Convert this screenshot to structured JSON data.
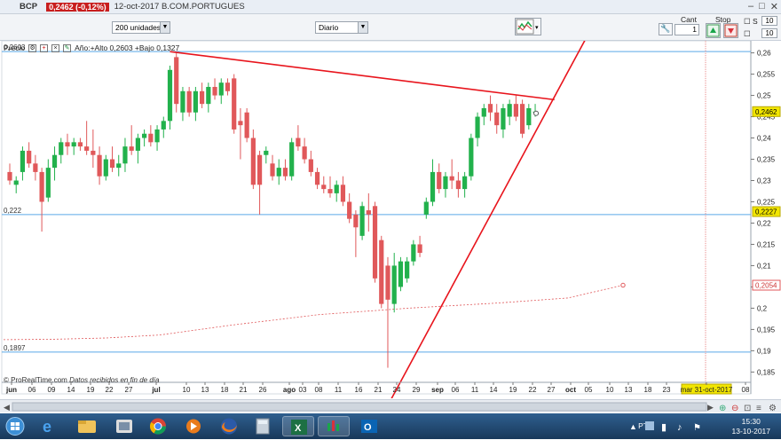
{
  "titlebar": {
    "symbol": "BCP",
    "price_change": "0,2462 (-0,12%)",
    "date_market": "12-oct-2017  B.COM.PORTUGUES"
  },
  "toolbar": {
    "units_value": "200 unidades",
    "period_value": "Diario",
    "cant_label": "Cant",
    "cant_value": "1",
    "stop_label": "Stop",
    "s_label": "S",
    "s_value": "10",
    "p_value": "10"
  },
  "legend": {
    "label": "Precio",
    "stats": "Año:+Alto 0,2603 +Bajo 0,1327"
  },
  "footer": {
    "provider": "© ProRealTime.com",
    "note": "Datos recibidos en fin de día"
  },
  "taskbar": {
    "lang": "PT",
    "time": "15:30",
    "date": "13-10-2017"
  },
  "colors": {
    "up": "#22b14c",
    "down": "#e0585a",
    "trend": "#e8141c",
    "hline": "#5aa9e6",
    "last_badge": "#f2e600"
  },
  "chart_data": {
    "type": "candlestick",
    "ylim": [
      0.182,
      0.264
    ],
    "y_ticks": [
      "0,26",
      "0,255",
      "0,25",
      "0,245",
      "0,24",
      "0,235",
      "0,23",
      "0,225",
      "0,22",
      "0,215",
      "0,21",
      "0,205",
      "0,2",
      "0,195",
      "0,19",
      "0,185"
    ],
    "y_tick_values": [
      0.26,
      0.255,
      0.25,
      0.245,
      0.24,
      0.235,
      0.23,
      0.225,
      0.22,
      0.215,
      0.21,
      0.205,
      0.2,
      0.195,
      0.19,
      0.185
    ],
    "x_labels": [
      "jun",
      "06",
      "09",
      "14",
      "19",
      "22",
      "27",
      "jul",
      "10",
      "13",
      "18",
      "21",
      "26",
      "ago",
      "03",
      "08",
      "11",
      "16",
      "21",
      "24",
      "29",
      "sep",
      "06",
      "11",
      "14",
      "19",
      "22",
      "27",
      "oct",
      "05",
      "10",
      "13",
      "18",
      "23",
      "mar 31-oct-2017",
      "08"
    ],
    "x_label_pos": [
      13,
      36,
      58,
      80,
      102,
      123,
      145,
      176,
      210,
      231,
      253,
      274,
      296,
      326,
      341,
      359,
      381,
      404,
      426,
      447,
      469,
      493,
      513,
      535,
      556,
      578,
      600,
      621,
      643,
      663,
      687,
      708,
      730,
      751,
      796,
      840
    ],
    "hlines": [
      {
        "label": "0,2603",
        "value": 0.2603
      },
      {
        "label": "0,222",
        "value": 0.222
      },
      {
        "label": "0,1897",
        "value": 0.1897
      }
    ],
    "right_badges": [
      {
        "label": "0,2462",
        "value": 0.2462,
        "kind": "last"
      },
      {
        "label": "0,2227",
        "value": 0.2227,
        "kind": "level"
      },
      {
        "label": "0,2054",
        "value": 0.2054,
        "kind": "ma"
      }
    ],
    "candles": [
      {
        "o": 0.232,
        "h": 0.234,
        "l": 0.229,
        "c": 0.23
      },
      {
        "o": 0.229,
        "h": 0.231,
        "l": 0.227,
        "c": 0.23
      },
      {
        "o": 0.232,
        "h": 0.238,
        "l": 0.23,
        "c": 0.237
      },
      {
        "o": 0.237,
        "h": 0.239,
        "l": 0.233,
        "c": 0.234
      },
      {
        "o": 0.234,
        "h": 0.236,
        "l": 0.23,
        "c": 0.232
      },
      {
        "o": 0.232,
        "h": 0.233,
        "l": 0.218,
        "c": 0.225
      },
      {
        "o": 0.226,
        "h": 0.235,
        "l": 0.225,
        "c": 0.233
      },
      {
        "o": 0.233,
        "h": 0.238,
        "l": 0.23,
        "c": 0.236
      },
      {
        "o": 0.236,
        "h": 0.24,
        "l": 0.234,
        "c": 0.239
      },
      {
        "o": 0.239,
        "h": 0.241,
        "l": 0.236,
        "c": 0.238
      },
      {
        "o": 0.238,
        "h": 0.24,
        "l": 0.236,
        "c": 0.239
      },
      {
        "o": 0.239,
        "h": 0.24,
        "l": 0.237,
        "c": 0.238
      },
      {
        "o": 0.238,
        "h": 0.244,
        "l": 0.236,
        "c": 0.237
      },
      {
        "o": 0.237,
        "h": 0.242,
        "l": 0.233,
        "c": 0.236
      },
      {
        "o": 0.236,
        "h": 0.238,
        "l": 0.229,
        "c": 0.231
      },
      {
        "o": 0.231,
        "h": 0.236,
        "l": 0.23,
        "c": 0.235
      },
      {
        "o": 0.235,
        "h": 0.238,
        "l": 0.232,
        "c": 0.233
      },
      {
        "o": 0.233,
        "h": 0.236,
        "l": 0.231,
        "c": 0.234
      },
      {
        "o": 0.234,
        "h": 0.24,
        "l": 0.232,
        "c": 0.238
      },
      {
        "o": 0.238,
        "h": 0.243,
        "l": 0.236,
        "c": 0.237
      },
      {
        "o": 0.237,
        "h": 0.241,
        "l": 0.234,
        "c": 0.24
      },
      {
        "o": 0.24,
        "h": 0.242,
        "l": 0.238,
        "c": 0.241
      },
      {
        "o": 0.241,
        "h": 0.243,
        "l": 0.238,
        "c": 0.239
      },
      {
        "o": 0.239,
        "h": 0.243,
        "l": 0.237,
        "c": 0.242
      },
      {
        "o": 0.242,
        "h": 0.245,
        "l": 0.24,
        "c": 0.244
      },
      {
        "o": 0.244,
        "h": 0.257,
        "l": 0.242,
        "c": 0.256
      },
      {
        "o": 0.259,
        "h": 0.26,
        "l": 0.246,
        "c": 0.248
      },
      {
        "o": 0.246,
        "h": 0.252,
        "l": 0.244,
        "c": 0.251
      },
      {
        "o": 0.251,
        "h": 0.252,
        "l": 0.245,
        "c": 0.246
      },
      {
        "o": 0.246,
        "h": 0.252,
        "l": 0.244,
        "c": 0.251
      },
      {
        "o": 0.251,
        "h": 0.253,
        "l": 0.247,
        "c": 0.248
      },
      {
        "o": 0.248,
        "h": 0.253,
        "l": 0.246,
        "c": 0.252
      },
      {
        "o": 0.252,
        "h": 0.254,
        "l": 0.249,
        "c": 0.25
      },
      {
        "o": 0.25,
        "h": 0.254,
        "l": 0.248,
        "c": 0.253
      },
      {
        "o": 0.253,
        "h": 0.254,
        "l": 0.25,
        "c": 0.251
      },
      {
        "o": 0.254,
        "h": 0.255,
        "l": 0.241,
        "c": 0.242
      },
      {
        "o": 0.244,
        "h": 0.247,
        "l": 0.235,
        "c": 0.243
      },
      {
        "o": 0.246,
        "h": 0.247,
        "l": 0.239,
        "c": 0.24
      },
      {
        "o": 0.24,
        "h": 0.242,
        "l": 0.228,
        "c": 0.229
      },
      {
        "o": 0.236,
        "h": 0.237,
        "l": 0.222,
        "c": 0.229
      },
      {
        "o": 0.236,
        "h": 0.238,
        "l": 0.234,
        "c": 0.237
      },
      {
        "o": 0.234,
        "h": 0.236,
        "l": 0.23,
        "c": 0.231
      },
      {
        "o": 0.231,
        "h": 0.235,
        "l": 0.229,
        "c": 0.233
      },
      {
        "o": 0.233,
        "h": 0.235,
        "l": 0.23,
        "c": 0.231
      },
      {
        "o": 0.231,
        "h": 0.24,
        "l": 0.23,
        "c": 0.239
      },
      {
        "o": 0.24,
        "h": 0.243,
        "l": 0.237,
        "c": 0.238
      },
      {
        "o": 0.238,
        "h": 0.24,
        "l": 0.234,
        "c": 0.235
      },
      {
        "o": 0.235,
        "h": 0.237,
        "l": 0.231,
        "c": 0.232
      },
      {
        "o": 0.232,
        "h": 0.233,
        "l": 0.228,
        "c": 0.229
      },
      {
        "o": 0.229,
        "h": 0.231,
        "l": 0.227,
        "c": 0.228
      },
      {
        "o": 0.228,
        "h": 0.231,
        "l": 0.226,
        "c": 0.227
      },
      {
        "o": 0.227,
        "h": 0.23,
        "l": 0.225,
        "c": 0.229
      },
      {
        "o": 0.229,
        "h": 0.231,
        "l": 0.224,
        "c": 0.225
      },
      {
        "o": 0.225,
        "h": 0.227,
        "l": 0.22,
        "c": 0.221
      },
      {
        "o": 0.222,
        "h": 0.223,
        "l": 0.212,
        "c": 0.219
      },
      {
        "o": 0.217,
        "h": 0.225,
        "l": 0.216,
        "c": 0.224
      },
      {
        "o": 0.223,
        "h": 0.227,
        "l": 0.218,
        "c": 0.222
      },
      {
        "o": 0.224,
        "h": 0.225,
        "l": 0.206,
        "c": 0.207
      },
      {
        "o": 0.216,
        "h": 0.217,
        "l": 0.2,
        "c": 0.201
      },
      {
        "o": 0.21,
        "h": 0.212,
        "l": 0.186,
        "c": 0.202
      },
      {
        "o": 0.201,
        "h": 0.213,
        "l": 0.199,
        "c": 0.21
      },
      {
        "o": 0.205,
        "h": 0.212,
        "l": 0.204,
        "c": 0.211
      },
      {
        "o": 0.207,
        "h": 0.212,
        "l": 0.206,
        "c": 0.211
      },
      {
        "o": 0.211,
        "h": 0.216,
        "l": 0.21,
        "c": 0.215
      },
      {
        "o": 0.215,
        "h": 0.217,
        "l": 0.212,
        "c": 0.213
      },
      {
        "o": 0.222,
        "h": 0.226,
        "l": 0.221,
        "c": 0.225
      },
      {
        "o": 0.225,
        "h": 0.235,
        "l": 0.224,
        "c": 0.232
      },
      {
        "o": 0.232,
        "h": 0.234,
        "l": 0.227,
        "c": 0.228
      },
      {
        "o": 0.228,
        "h": 0.232,
        "l": 0.226,
        "c": 0.231
      },
      {
        "o": 0.231,
        "h": 0.235,
        "l": 0.228,
        "c": 0.23
      },
      {
        "o": 0.23,
        "h": 0.232,
        "l": 0.226,
        "c": 0.228
      },
      {
        "o": 0.228,
        "h": 0.232,
        "l": 0.226,
        "c": 0.231
      },
      {
        "o": 0.231,
        "h": 0.241,
        "l": 0.23,
        "c": 0.24
      },
      {
        "o": 0.24,
        "h": 0.246,
        "l": 0.238,
        "c": 0.245
      },
      {
        "o": 0.245,
        "h": 0.248,
        "l": 0.243,
        "c": 0.247
      },
      {
        "o": 0.248,
        "h": 0.25,
        "l": 0.244,
        "c": 0.246
      },
      {
        "o": 0.246,
        "h": 0.248,
        "l": 0.241,
        "c": 0.243
      },
      {
        "o": 0.242,
        "h": 0.248,
        "l": 0.24,
        "c": 0.247
      },
      {
        "o": 0.245,
        "h": 0.249,
        "l": 0.243,
        "c": 0.248
      },
      {
        "o": 0.248,
        "h": 0.25,
        "l": 0.244,
        "c": 0.245
      },
      {
        "o": 0.248,
        "h": 0.249,
        "l": 0.24,
        "c": 0.241
      },
      {
        "o": 0.243,
        "h": 0.248,
        "l": 0.242,
        "c": 0.247
      },
      {
        "o": 0.246,
        "h": 0.248,
        "l": 0.245,
        "c": 0.2462
      }
    ],
    "moving_average": [
      0.1926,
      0.1927,
      0.193,
      0.1937,
      0.196,
      0.1985,
      0.2,
      0.2012,
      0.2024,
      0.2054
    ],
    "trendlines": [
      {
        "from": {
          "candle": 25,
          "value": 0.2603
        },
        "to": {
          "candle": 85,
          "value": 0.249
        }
      },
      {
        "from": {
          "candle": 55,
          "value": 0.166
        },
        "to": {
          "candle": 93,
          "value": 0.272
        }
      }
    ],
    "vline_label": "mar 31-oct-2017"
  }
}
